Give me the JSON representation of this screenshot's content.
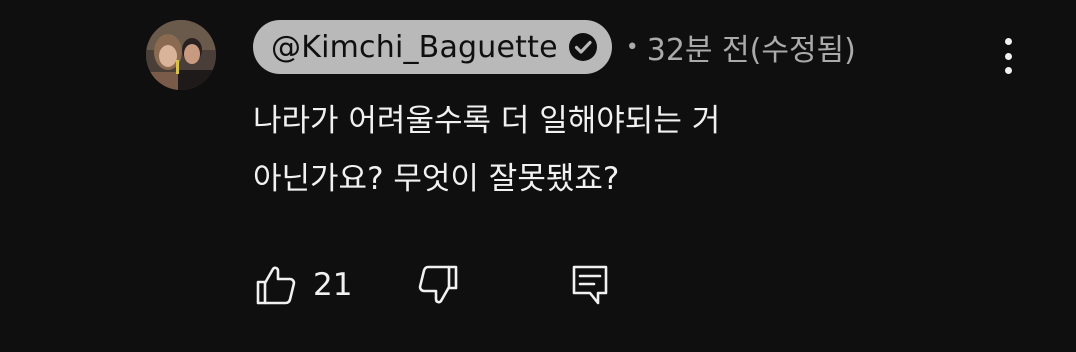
{
  "comment": {
    "author": "@Kimchi_Baguette",
    "meta_dot": "•",
    "timestamp": "32분 전(수정됨)",
    "text_lines": [
      "나라가 어려울수록 더 일해야되는 거",
      "아닌가요? 무엇이 잘못됐죠?"
    ],
    "like_count": "21"
  },
  "icons": {
    "avatar": "profile-photo",
    "verified": "check-circle-icon",
    "menu": "more-vertical-icon",
    "like": "thumbs-up-icon",
    "dislike": "thumbs-down-icon",
    "reply": "reply-comment-icon"
  },
  "colors": {
    "background": "#0f0f0f",
    "chip_background": "#b9b9b9",
    "text_primary": "#f1f1f1",
    "text_secondary": "#aaaaaa"
  }
}
